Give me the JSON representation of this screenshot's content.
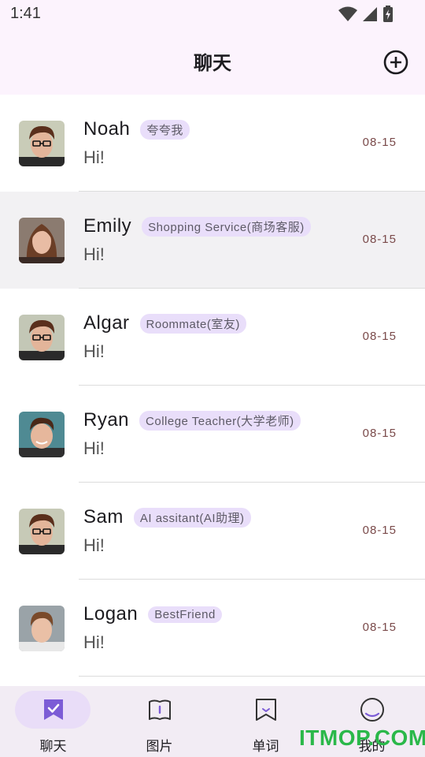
{
  "status_bar": {
    "time": "1:41"
  },
  "header": {
    "title": "聊天"
  },
  "chats": [
    {
      "name": "Noah",
      "role": "夸夸我",
      "message": "Hi!",
      "date": "08-15",
      "avatar": "boy-glasses"
    },
    {
      "name": "Emily",
      "role": "Shopping Service(商场客服)",
      "message": "Hi!",
      "date": "08-15",
      "avatar": "girl"
    },
    {
      "name": "Algar",
      "role": "Roommate(室友)",
      "message": "Hi!",
      "date": "08-15",
      "avatar": "boy-glasses"
    },
    {
      "name": "Ryan",
      "role": "College Teacher(大学老师)",
      "message": "Hi!",
      "date": "08-15",
      "avatar": "boy-smile"
    },
    {
      "name": "Sam",
      "role": "AI assitant(AI助理)",
      "message": "Hi!",
      "date": "08-15",
      "avatar": "boy-glasses"
    },
    {
      "name": "Logan",
      "role": "BestFriend",
      "message": "Hi!",
      "date": "08-15",
      "avatar": "boy-young"
    }
  ],
  "bottom_nav": [
    {
      "label": "聊天",
      "icon": "chat-check-icon",
      "active": true
    },
    {
      "label": "图片",
      "icon": "book-icon"
    },
    {
      "label": "单词",
      "icon": "bookmark-icon"
    },
    {
      "label": "我的",
      "icon": "profile-icon"
    }
  ],
  "watermark": "ITMOP.COM",
  "colors": {
    "app_bar": "#fcf3fd",
    "badge": "#e9defa",
    "nav_active": "#e9ddf8",
    "accent": "#7c5cd6"
  }
}
